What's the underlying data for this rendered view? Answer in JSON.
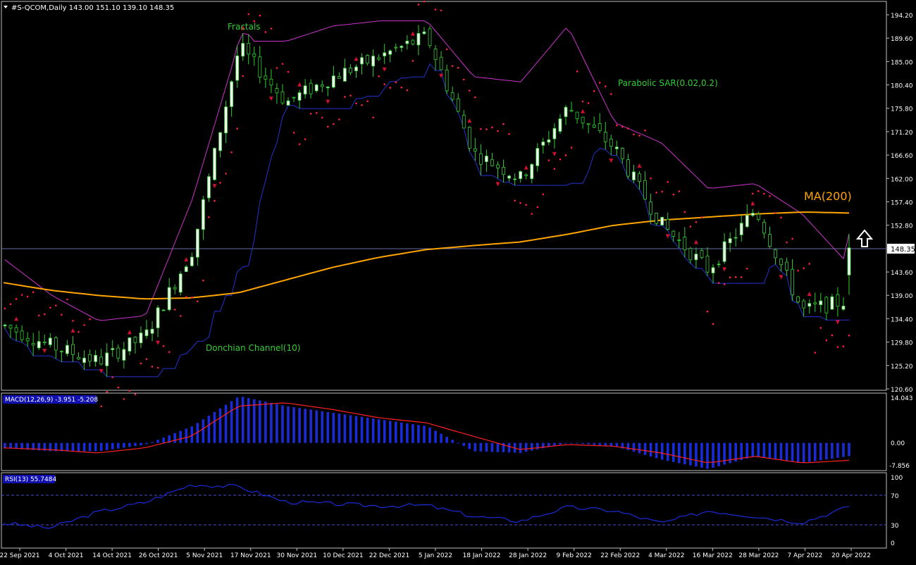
{
  "header": {
    "symbol_line": "#S-QCOM,Daily  143.00 151.10 139.10 148.35"
  },
  "price_panel": {
    "price_ticks": [
      "194.20",
      "189.60",
      "185.00",
      "180.40",
      "175.80",
      "171.20",
      "166.60",
      "162.00",
      "157.40",
      "152.80",
      "148.35",
      "143.60",
      "139.00",
      "134.40",
      "129.80",
      "125.20",
      "120.60"
    ],
    "current_price_label": "148.35",
    "annotations": {
      "fractals": "Fractals",
      "parabolic_sar": "Parabolic SAR(0.02,0.2)",
      "donchian": "Donchian Channel(10)",
      "ma200": "MA(200)"
    }
  },
  "macd_panel": {
    "label": "MACD(12,26,9) -3.951 -5.208",
    "ticks": [
      "14.043",
      "0.00",
      "-7.856"
    ]
  },
  "rsi_panel": {
    "label": "RSI(13) 55.7484",
    "ticks": [
      "100",
      "70",
      "30",
      "0"
    ]
  },
  "x_axis": {
    "dates": [
      "22 Sep 2021",
      "4 Oct 2021",
      "14 Oct 2021",
      "26 Oct 2021",
      "5 Nov 2021",
      "17 Nov 2021",
      "30 Nov 2021",
      "10 Dec 2021",
      "22 Dec 2021",
      "5 Jan 2022",
      "18 Jan 2022",
      "28 Jan 2022",
      "9 Feb 2022",
      "22 Feb 2022",
      "4 Mar 2022",
      "16 Mar 2022",
      "28 Mar 2022",
      "7 Apr 2022",
      "20 Apr 2022"
    ]
  },
  "colors": {
    "bull_candle": "#f0fff0",
    "candle_outline": "#32cd32",
    "ma200": "#ffa500",
    "donchian_upper": "#cc33cc",
    "donchian_lower": "#2233cc",
    "sar": "#ff2244",
    "macd_hist": "#1a2bd8",
    "macd_signal": "#ff2020",
    "rsi": "#1a2bd8"
  },
  "chart_data": [
    {
      "type": "line",
      "title": "#S-QCOM,Daily",
      "x": [
        "22 Sep 2021",
        "4 Oct 2021",
        "14 Oct 2021",
        "26 Oct 2021",
        "5 Nov 2021",
        "17 Nov 2021",
        "30 Nov 2021",
        "10 Dec 2021",
        "22 Dec 2021",
        "5 Jan 2022",
        "18 Jan 2022",
        "28 Jan 2022",
        "9 Feb 2022",
        "22 Feb 2022",
        "4 Mar 2022",
        "16 Mar 2022",
        "28 Mar 2022",
        "7 Apr 2022",
        "20 Apr 2022"
      ],
      "series": [
        {
          "name": "#S-QCOM",
          "values": [
            133,
            129,
            126,
            131,
            148,
            188,
            177,
            182,
            186,
            190,
            167,
            162,
            176,
            168,
            153,
            144,
            156,
            136,
            138
          ]
        },
        {
          "name": "MA(200)",
          "values": [
            141.5,
            140,
            139,
            138.3,
            138.5,
            139.5,
            142,
            144.5,
            146.5,
            148,
            148.8,
            149.5,
            151,
            152.8,
            153.8,
            154.4,
            155,
            155.4,
            155.2
          ]
        },
        {
          "name": "Donchian Channel(10)",
          "values": [
            146,
            139,
            134,
            135,
            158,
            189,
            189,
            192,
            193,
            193,
            182,
            181,
            192,
            173,
            169,
            160,
            161,
            155,
            145
          ]
        }
      ],
      "ylim": [
        120.6,
        196
      ],
      "last_ohlc": {
        "open": 143.0,
        "high": 151.1,
        "low": 139.1,
        "close": 148.35
      }
    },
    {
      "type": "bar",
      "title": "MACD(12,26,9) -3.951 -5.208",
      "x": [
        "22 Sep 2021",
        "4 Oct 2021",
        "14 Oct 2021",
        "26 Oct 2021",
        "5 Nov 2021",
        "17 Nov 2021",
        "30 Nov 2021",
        "10 Dec 2021",
        "22 Dec 2021",
        "5 Jan 2022",
        "18 Jan 2022",
        "28 Jan 2022",
        "9 Feb 2022",
        "22 Feb 2022",
        "4 Mar 2022",
        "16 Mar 2022",
        "28 Mar 2022",
        "7 Apr 2022",
        "20 Apr 2022"
      ],
      "series": [
        {
          "name": "MACD",
          "values": [
            -1.5,
            -2.5,
            -2.5,
            -0.5,
            5,
            14,
            11,
            9,
            7,
            5,
            -2.5,
            -3,
            0,
            -1,
            -5,
            -7.8,
            -4,
            -6,
            -3.951
          ]
        },
        {
          "name": "Signal",
          "values": [
            -1.5,
            -2,
            -3,
            -1.5,
            2,
            11,
            12,
            10,
            7.5,
            6,
            2,
            -2,
            -0.5,
            -1,
            -3,
            -6,
            -4,
            -6,
            -5.208
          ]
        }
      ],
      "ylim": [
        -7.856,
        14.043
      ]
    },
    {
      "type": "line",
      "title": "RSI(13) 55.7484",
      "x": [
        "22 Sep 2021",
        "4 Oct 2021",
        "14 Oct 2021",
        "26 Oct 2021",
        "5 Nov 2021",
        "17 Nov 2021",
        "30 Nov 2021",
        "10 Dec 2021",
        "22 Dec 2021",
        "5 Jan 2022",
        "18 Jan 2022",
        "28 Jan 2022",
        "9 Feb 2022",
        "22 Feb 2022",
        "4 Mar 2022",
        "16 Mar 2022",
        "28 Mar 2022",
        "7 Apr 2022",
        "20 Apr 2022"
      ],
      "series": [
        {
          "name": "RSI(13)",
          "values": [
            32,
            25,
            48,
            62,
            88,
            85,
            63,
            60,
            57,
            58,
            42,
            35,
            55,
            50,
            32,
            50,
            42,
            33,
            55.7484
          ]
        }
      ],
      "ylim": [
        0,
        100
      ],
      "levels": [
        70,
        30
      ]
    }
  ]
}
